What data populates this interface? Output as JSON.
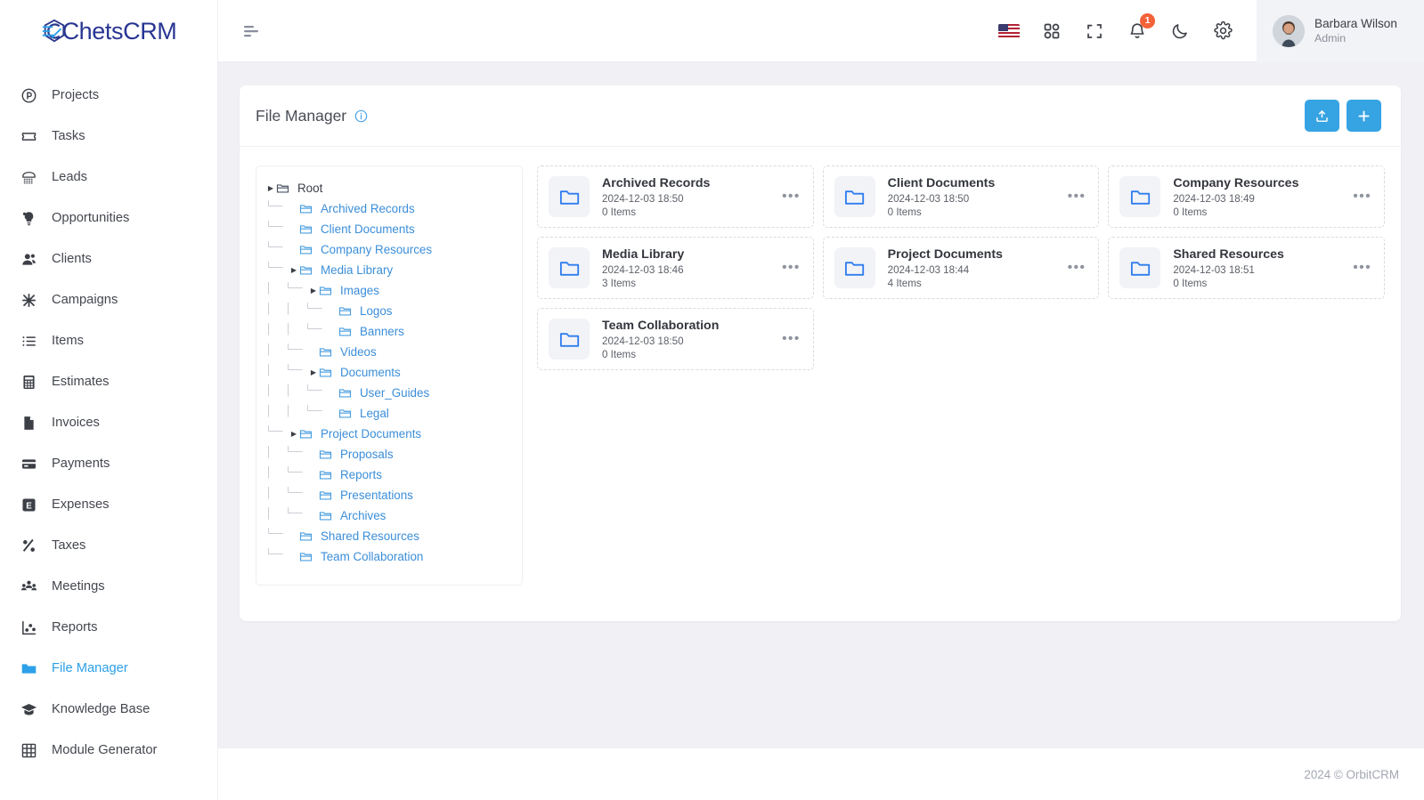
{
  "brand": {
    "name": "ChetsCRM",
    "mark": "crm-logo-icon"
  },
  "sidebar": {
    "items": [
      {
        "label": "Projects",
        "icon": "circle-p-icon",
        "active": false
      },
      {
        "label": "Tasks",
        "icon": "ticket-icon",
        "active": false
      },
      {
        "label": "Leads",
        "icon": "telephone-icon",
        "active": false
      },
      {
        "label": "Opportunities",
        "icon": "lightbulb-icon",
        "active": false
      },
      {
        "label": "Clients",
        "icon": "user-group-icon",
        "active": false
      },
      {
        "label": "Campaigns",
        "icon": "asterisk-icon",
        "active": false
      },
      {
        "label": "Items",
        "icon": "list-icon",
        "active": false
      },
      {
        "label": "Estimates",
        "icon": "calculator-icon",
        "active": false
      },
      {
        "label": "Invoices",
        "icon": "document-icon",
        "active": false
      },
      {
        "label": "Payments",
        "icon": "credit-card-icon",
        "active": false
      },
      {
        "label": "Expenses",
        "icon": "e-square-icon",
        "active": false
      },
      {
        "label": "Taxes",
        "icon": "percent-icon",
        "active": false
      },
      {
        "label": "Meetings",
        "icon": "people-icon",
        "active": false
      },
      {
        "label": "Reports",
        "icon": "chart-dots-icon",
        "active": false
      },
      {
        "label": "File Manager",
        "icon": "folder-filled-icon",
        "active": true
      },
      {
        "label": "Knowledge Base",
        "icon": "graduation-cap-icon",
        "active": false
      },
      {
        "label": "Module Generator",
        "icon": "grid-table-icon",
        "active": false
      }
    ]
  },
  "topbar": {
    "collapse_icon": "sidebar-collapse-icon",
    "icons": [
      {
        "name": "language-flag-us",
        "label": "US"
      },
      {
        "name": "apps-grid-icon",
        "label": ""
      },
      {
        "name": "fullscreen-icon",
        "label": ""
      },
      {
        "name": "bell-icon",
        "label": "",
        "badge": "1"
      },
      {
        "name": "dark-mode-icon",
        "label": ""
      },
      {
        "name": "settings-gear-icon",
        "label": ""
      }
    ],
    "user": {
      "name": "Barbara Wilson",
      "role": "Admin"
    }
  },
  "page": {
    "title": "File Manager",
    "info_icon": "info-circle-icon",
    "actions": [
      {
        "name": "upload-button",
        "icon": "upload-icon"
      },
      {
        "name": "add-folder-button",
        "icon": "plus-icon"
      }
    ]
  },
  "tree": {
    "nodes": [
      {
        "label": "Root",
        "depth": 0,
        "caret": true,
        "root": true
      },
      {
        "label": "Archived Records",
        "depth": 1,
        "caret": false,
        "root": false
      },
      {
        "label": "Client Documents",
        "depth": 1,
        "caret": false,
        "root": false
      },
      {
        "label": "Company Resources",
        "depth": 1,
        "caret": false,
        "root": false
      },
      {
        "label": "Media Library",
        "depth": 1,
        "caret": true,
        "root": false
      },
      {
        "label": "Images",
        "depth": 2,
        "caret": true,
        "root": false
      },
      {
        "label": "Logos",
        "depth": 3,
        "caret": false,
        "root": false
      },
      {
        "label": "Banners",
        "depth": 3,
        "caret": false,
        "root": false
      },
      {
        "label": "Videos",
        "depth": 2,
        "caret": false,
        "root": false
      },
      {
        "label": "Documents",
        "depth": 2,
        "caret": true,
        "root": false
      },
      {
        "label": "User_Guides",
        "depth": 3,
        "caret": false,
        "root": false
      },
      {
        "label": "Legal",
        "depth": 3,
        "caret": false,
        "root": false
      },
      {
        "label": "Project Documents",
        "depth": 1,
        "caret": true,
        "root": false
      },
      {
        "label": "Proposals",
        "depth": 2,
        "caret": false,
        "root": false
      },
      {
        "label": "Reports",
        "depth": 2,
        "caret": false,
        "root": false
      },
      {
        "label": "Presentations",
        "depth": 2,
        "caret": false,
        "root": false
      },
      {
        "label": "Archives",
        "depth": 2,
        "caret": false,
        "root": false
      },
      {
        "label": "Shared Resources",
        "depth": 1,
        "caret": false,
        "root": false
      },
      {
        "label": "Team Collaboration",
        "depth": 1,
        "caret": false,
        "root": false
      }
    ]
  },
  "folders": [
    {
      "name": "Archived Records",
      "date": "2024-12-03 18:50",
      "items": "0 Items"
    },
    {
      "name": "Client Documents",
      "date": "2024-12-03 18:50",
      "items": "0 Items"
    },
    {
      "name": "Company Resources",
      "date": "2024-12-03 18:49",
      "items": "0 Items"
    },
    {
      "name": "Media Library",
      "date": "2024-12-03 18:46",
      "items": "3 Items"
    },
    {
      "name": "Project Documents",
      "date": "2024-12-03 18:44",
      "items": "4 Items"
    },
    {
      "name": "Shared Resources",
      "date": "2024-12-03 18:51",
      "items": "0 Items"
    },
    {
      "name": "Team Collaboration",
      "date": "2024-12-03 18:50",
      "items": "0 Items"
    }
  ],
  "footer": {
    "text": "2024 © OrbitCRM"
  },
  "colors": {
    "accent": "#36a3e3",
    "brand_text": "#283593",
    "tree_link": "#3b8ed9",
    "badge": "#f4623a",
    "page_bg": "#f0f0f5"
  }
}
